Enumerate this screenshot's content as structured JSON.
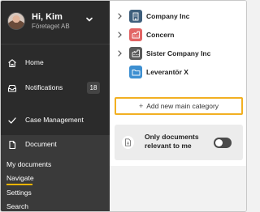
{
  "user": {
    "name": "Hi, Kim",
    "company": "Företaget AB"
  },
  "nav": {
    "home": "Home",
    "notifications": "Notifications",
    "notifications_count": "18",
    "case_management": "Case Management",
    "document": "Document"
  },
  "subnav": {
    "items": [
      "My documents",
      "Navigate",
      "Settings",
      "Search"
    ],
    "active": "Navigate"
  },
  "tree": {
    "items": [
      {
        "label": "Company Inc",
        "icon": "building-icon",
        "color": "#3f5f7c"
      },
      {
        "label": "Concern",
        "icon": "building-icon",
        "color": "#e26464"
      },
      {
        "label": "Sister Company Inc",
        "icon": "building-icon",
        "color": "#5a5a5a"
      },
      {
        "label": "Leverantör X",
        "icon": "folder-icon",
        "color": "#3d8fd1"
      }
    ]
  },
  "actions": {
    "add_main_category": "Add new main category"
  },
  "filter": {
    "label": "Only documents relevant to me",
    "enabled": false
  },
  "colors": {
    "sidebar_bg": "#2b2b2b",
    "accent": "#f2b021"
  }
}
